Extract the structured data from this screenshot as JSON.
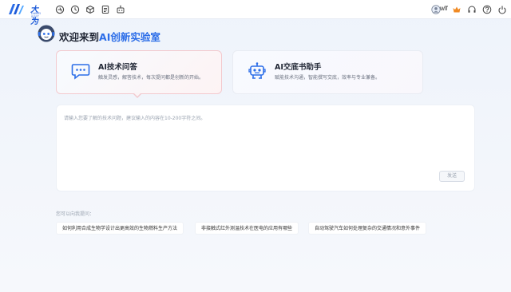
{
  "topbar": {
    "logo_text": "大为",
    "logo_sub": "DAWEI SOFT",
    "icons": [
      "translate-icon",
      "history-icon",
      "cube-icon",
      "document-icon",
      "robot-icon"
    ],
    "user_name": "wlf",
    "right_icons": [
      "user-icon",
      "crown-icon",
      "headset-icon",
      "help-icon",
      "power-icon"
    ]
  },
  "welcome": {
    "title_prefix": "欢迎来到",
    "title_accent": "AI创新实验室"
  },
  "cards": [
    {
      "title": "AI技术问答",
      "description": "触发灵感，解答技术，每次提问都是创新的开始。",
      "icon": "chat-bubble-icon"
    },
    {
      "title": "AI交底书助手",
      "description": "赋能技术沟通，智能撰写交底，效率与专业兼备。",
      "icon": "robot-icon"
    }
  ],
  "input": {
    "placeholder": "请输入您要了解的技术问题，建议输入的内容在10-200字符之间。",
    "send_label": "发送"
  },
  "suggestions": {
    "label": "您可以向我提问：",
    "items": [
      "如何利用合成生物学设计出更高效的生物燃料生产方法",
      "非接触式红外测温技术在医电的应用有哪些",
      "自动驾驶汽车如何处理复杂的交通情况和意外事件"
    ]
  },
  "colors": {
    "accent": "#2b6de8",
    "brand": "#1e5bd8",
    "crown": "#f08a24",
    "active_card_border": "#f3c9ce"
  }
}
